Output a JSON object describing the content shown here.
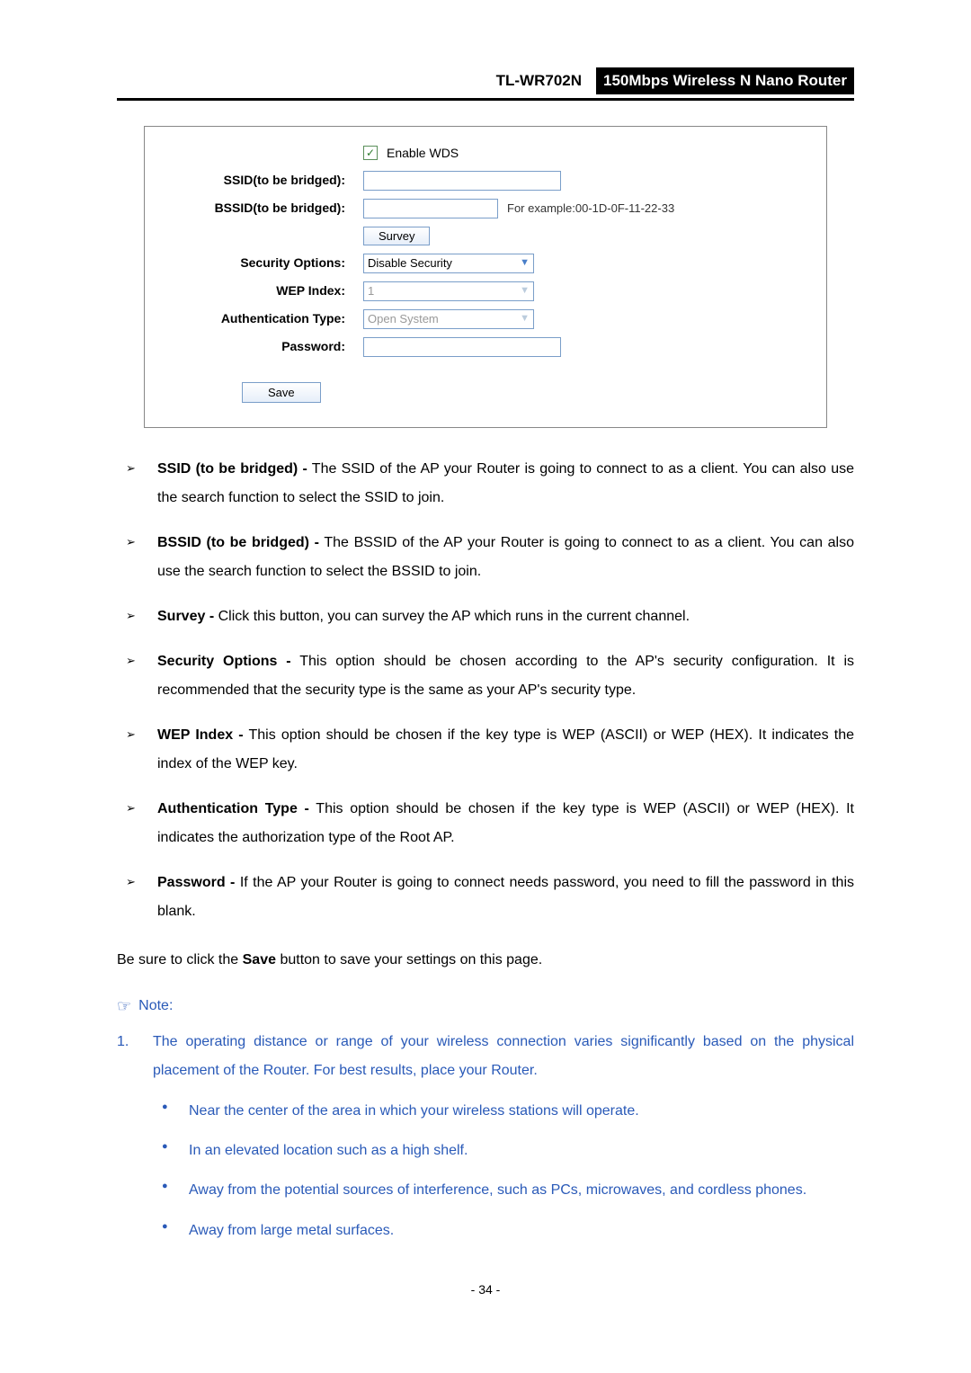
{
  "header": {
    "model": "TL-WR702N",
    "description": "150Mbps  Wireless  N  Nano  Router"
  },
  "panel": {
    "enable_wds_label": "Enable WDS",
    "enable_wds_checked": true,
    "ssid_label": "SSID(to be bridged):",
    "ssid_value": "",
    "bssid_label": "BSSID(to be bridged):",
    "bssid_value": "",
    "bssid_hint": "For example:00-1D-0F-11-22-33",
    "survey_btn": "Survey",
    "security_label": "Security Options:",
    "security_value": "Disable Security",
    "wep_index_label": "WEP Index:",
    "wep_index_value": "1",
    "auth_type_label": "Authentication Type:",
    "auth_type_value": "Open System",
    "password_label": "Password:",
    "password_value": "",
    "save_btn": "Save"
  },
  "bullets": {
    "ssid_title": "SSID (to be bridged) -",
    "ssid_text": " The SSID of the AP your Router is going to connect to as a client. You can also use the search function to select the SSID to join.",
    "bssid_title": "BSSID (to be bridged) -",
    "bssid_text": " The BSSID of the AP your Router is going to connect to as a client. You can also use the search function to select the BSSID to join.",
    "survey_title": "Survey -",
    "survey_text": " Click this button, you can survey the AP which runs in the current channel.",
    "security_title": "Security Options -",
    "security_text": " This option should be chosen according to the AP's security configuration. It is recommended that the security type is the same as your AP's security type.",
    "wep_title": "WEP Index -",
    "wep_text": " This option should be chosen if the key type is WEP (ASCII) or WEP (HEX). It indicates the index of the WEP key.",
    "auth_title": "Authentication Type -",
    "auth_text": " This option should be chosen if the key type is WEP (ASCII) or WEP (HEX). It indicates the authorization type of the Root AP.",
    "pass_title": "Password -",
    "pass_text": " If the AP your Router is going to connect needs password, you need to fill the password in this blank."
  },
  "save_line_pre": "Be sure to click the ",
  "save_line_bold": "Save",
  "save_line_post": " button to save your settings on this page.",
  "note_label": "Note:",
  "note_main": "The operating distance or range of your wireless connection varies significantly based on the physical placement of the Router. For best results, place your Router.",
  "note_items": {
    "a": "Near the center of the area in which your wireless stations will operate.",
    "b": "In an elevated location such as a high shelf.",
    "c": "Away from the potential sources of interference, such as PCs, microwaves, and cordless phones.",
    "d": "Away from large metal surfaces."
  },
  "page_number": "- 34 -"
}
